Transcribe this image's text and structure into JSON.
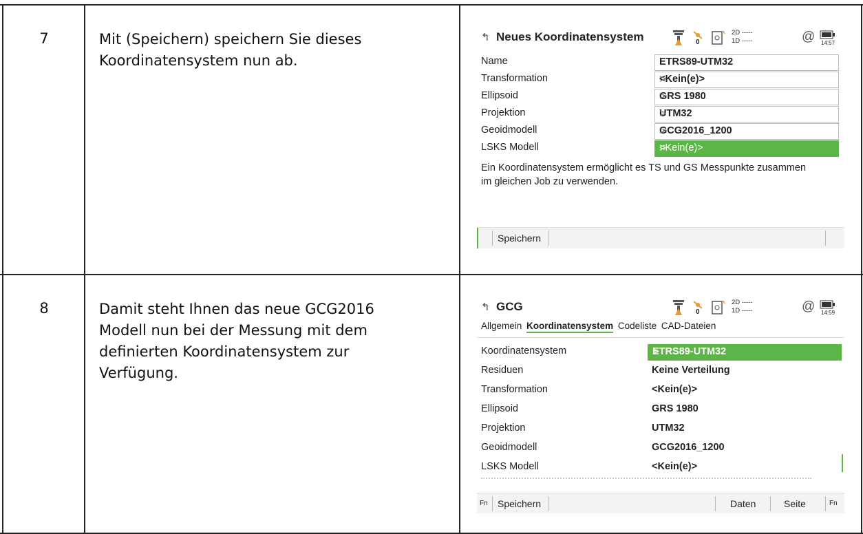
{
  "rows": [
    {
      "step": "7",
      "description": [
        "Mit (Speichern) speichern Sie dieses",
        "Koordinatensystem nun ab."
      ],
      "screen": {
        "title": "Neues Koordinatensystem",
        "status": {
          "sat_count": "0",
          "quality_2d": "2D -----",
          "quality_1d": "1D -----",
          "time": "14:57"
        },
        "fields": [
          {
            "label": "Name",
            "value": "ETRS89-UTM32"
          },
          {
            "label": "Transformation",
            "value": "<Kein(e)>"
          },
          {
            "label": "Ellipsoid",
            "value": "GRS 1980"
          },
          {
            "label": "Projektion",
            "value": "UTM32"
          },
          {
            "label": "Geoidmodell",
            "value": "GCG2016_1200"
          },
          {
            "label": "LSKS Modell",
            "value": "<Kein(e)>"
          }
        ],
        "info": [
          "Ein Koordinatensystem ermöglicht es TS und GS Messpunkte zusammen",
          "im gleichen Job zu verwenden."
        ],
        "softkeys": {
          "save": "Speichern"
        }
      }
    },
    {
      "step": "8",
      "description": [
        "Damit steht Ihnen das neue GCG2016",
        "Modell nun bei der Messung mit dem",
        "definierten Koordinatensystem zur",
        "Verfügung."
      ],
      "screen": {
        "title": "GCG",
        "status": {
          "sat_count": "0",
          "quality_2d": "2D -----",
          "quality_1d": "1D -----",
          "time": "14:59"
        },
        "tabs": [
          "Allgemein",
          "Koordinatensystem",
          "Codeliste",
          "CAD-Dateien"
        ],
        "fields": [
          {
            "label": "Koordinatensystem",
            "value": "ETRS89-UTM32"
          },
          {
            "label": "Residuen",
            "value": "Keine Verteilung"
          },
          {
            "label": "Transformation",
            "value": "<Kein(e)>"
          },
          {
            "label": "Ellipsoid",
            "value": "GRS 1980"
          },
          {
            "label": "Projektion",
            "value": "UTM32"
          },
          {
            "label": "Geoidmodell",
            "value": "GCG2016_1200"
          },
          {
            "label": "LSKS Modell",
            "value": "<Kein(e)>"
          }
        ],
        "softkeys": {
          "fn_left": "Fn",
          "save": "Speichern",
          "data": "Daten",
          "page": "Seite",
          "fn_right": "Fn"
        }
      }
    }
  ],
  "colors": {
    "accent": "#5cb546",
    "border": "#222222"
  }
}
